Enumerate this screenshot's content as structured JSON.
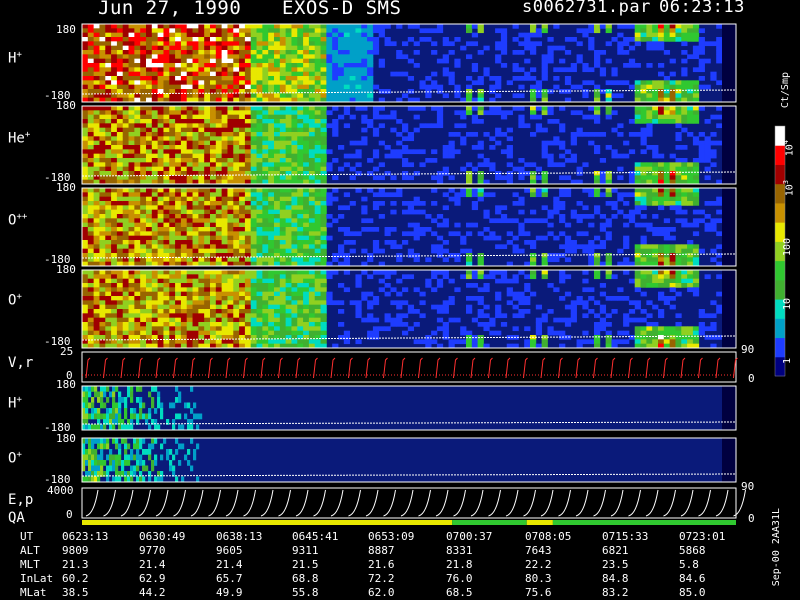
{
  "header": {
    "date": "Jun 27, 1990",
    "instrument": "EXOS-D SMS",
    "file": "s0062731.par",
    "time": "06:23:13"
  },
  "colorbar": {
    "unit": "Ct/Smp",
    "tick_labels": [
      "1",
      "10",
      "100",
      "10",
      "10",
      "3",
      "4"
    ],
    "colors": [
      "#00007f",
      "#1e3cff",
      "#00a0c8",
      "#00dcc0",
      "#40b030",
      "#30c830",
      "#90d020",
      "#e8e800",
      "#c89000",
      "#986400",
      "#a00000",
      "#ff0000",
      "#ffffff"
    ]
  },
  "panels": [
    {
      "id": "h-plus",
      "label": "H",
      "sup": "+",
      "top": "180",
      "bottom": "-180"
    },
    {
      "id": "he-plus",
      "label": "He",
      "sup": "+",
      "top": "180",
      "bottom": "-180"
    },
    {
      "id": "o-plusplus",
      "label": "O",
      "sup": "++",
      "top": "180",
      "bottom": "-180"
    },
    {
      "id": "o-plus",
      "label": "O",
      "sup": "+",
      "top": "180",
      "bottom": "-180"
    }
  ],
  "vr_panel": {
    "label": "V,r",
    "top": "25",
    "zero": "0",
    "right": "90",
    "right_zero": "0"
  },
  "lower_panels": [
    {
      "id": "h-plus-2",
      "label": "H",
      "sup": "+",
      "top": "180",
      "bottom": "-180"
    },
    {
      "id": "o-plus-2",
      "label": "O",
      "sup": "+",
      "top": "180",
      "bottom": "-180"
    }
  ],
  "ep_panel": {
    "label1": "E,p",
    "label2": "QA",
    "top": "4000",
    "zero": "0",
    "right": "90",
    "right_zero": "0"
  },
  "ephemeris": {
    "labels": [
      "UT",
      "ALT",
      "MLT",
      "InLat",
      "MLat"
    ],
    "columns": [
      [
        "0623:13",
        "9809",
        "21.3",
        "60.2",
        "38.5"
      ],
      [
        "0630:49",
        "9770",
        "21.4",
        "62.9",
        "44.2"
      ],
      [
        "0638:13",
        "9605",
        "21.4",
        "65.7",
        "49.9"
      ],
      [
        "0645:41",
        "9311",
        "21.5",
        "68.8",
        "55.8"
      ],
      [
        "0653:09",
        "8887",
        "21.6",
        "72.2",
        "62.0"
      ],
      [
        "0700:37",
        "8331",
        "21.8",
        "76.0",
        "68.5"
      ],
      [
        "0708:05",
        "7643",
        "22.2",
        "80.3",
        "75.6"
      ],
      [
        "0715:33",
        "6821",
        "23.5",
        "84.8",
        "83.2"
      ],
      [
        "0723:01",
        "5868",
        "5.8",
        "84.6",
        "85.0"
      ]
    ]
  },
  "footer": "Sep-00 2AA31L",
  "chart_data": {
    "type": "heatmap",
    "title": "Jun 27, 1990 EXOS-D SMS",
    "xlabel": "UT",
    "x_ticks": [
      "0623:13",
      "0630:49",
      "0638:13",
      "0645:41",
      "0653:09",
      "0700:37",
      "0708:05",
      "0715:33",
      "0723:01"
    ],
    "y_range_pitch": [
      -180,
      180
    ],
    "color_scale": "log",
    "color_range": [
      1,
      10000
    ],
    "color_unit": "Ct/Smp",
    "qa_bar": [
      {
        "from": "0623:13",
        "to": "0700:37",
        "color": "#e8e800"
      },
      {
        "from": "0700:37",
        "to": "0706:00",
        "color": "#30c830"
      },
      {
        "from": "0706:00",
        "to": "0708:05",
        "color": "#e8e800"
      },
      {
        "from": "0708:05",
        "to": "0723:01",
        "color": "#30c830"
      }
    ]
  }
}
